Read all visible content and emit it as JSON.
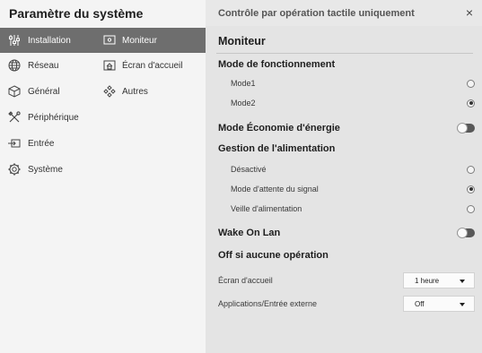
{
  "header": {
    "title": "Paramètre du système",
    "subtitle": "Contrôle par opération tactile uniquement",
    "close_glyph": "×"
  },
  "categories": [
    {
      "label": "Installation",
      "icon": "sliders-icon",
      "active": true
    },
    {
      "label": "Réseau",
      "icon": "globe-icon",
      "active": false
    },
    {
      "label": "Général",
      "icon": "cube-icon",
      "active": false
    },
    {
      "label": "Périphérique",
      "icon": "tools-icon",
      "active": false
    },
    {
      "label": "Entrée",
      "icon": "input-icon",
      "active": false
    },
    {
      "label": "Système",
      "icon": "gear-icon",
      "active": false
    }
  ],
  "subitems": [
    {
      "label": "Moniteur",
      "icon": "monitor-icon",
      "active": true
    },
    {
      "label": "Écran d'accueil",
      "icon": "home-screen-icon",
      "active": false
    },
    {
      "label": "Autres",
      "icon": "diamonds-icon",
      "active": false
    }
  ],
  "panel": {
    "title": "Moniteur",
    "operation_mode": {
      "heading": "Mode de fonctionnement",
      "options": [
        {
          "label": "Mode1",
          "selected": false
        },
        {
          "label": "Mode2",
          "selected": true
        }
      ]
    },
    "eco_mode": {
      "label": "Mode Économie d'énergie",
      "on": false
    },
    "power_management": {
      "heading": "Gestion de l'alimentation",
      "options": [
        {
          "label": "Désactivé",
          "selected": false
        },
        {
          "label": "Mode d'attente du signal",
          "selected": true
        },
        {
          "label": "Veille d'alimentation",
          "selected": false
        }
      ]
    },
    "wake_on_lan": {
      "label": "Wake On Lan",
      "on": false
    },
    "off_no_operation": {
      "heading": "Off si aucune opération",
      "rows": [
        {
          "label": "Écran d'accueil",
          "value": "1 heure"
        },
        {
          "label": "Applications/Entrée externe",
          "value": "Off"
        }
      ]
    }
  },
  "colors": {
    "active_item_bg": "#6e6e6e",
    "panel_bg": "#e4e4e4",
    "sidebar_bg": "#f4f4f4"
  }
}
